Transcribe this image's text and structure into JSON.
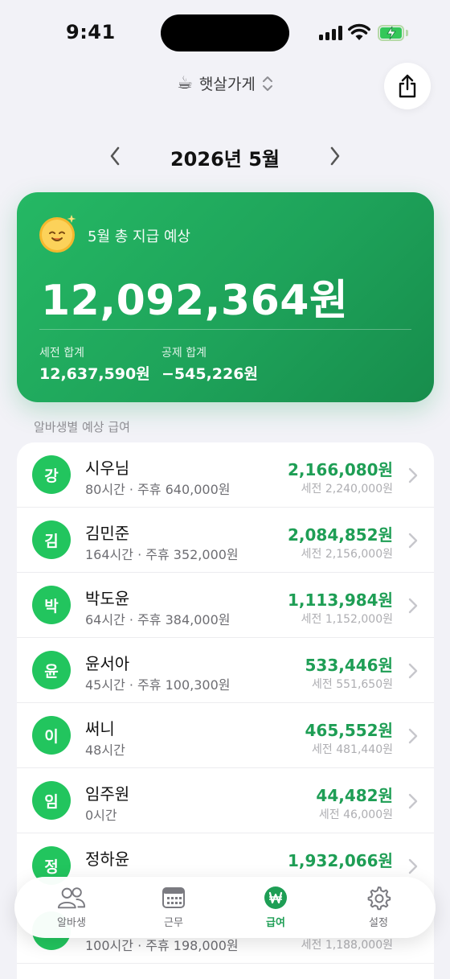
{
  "status": {
    "time": "9:41"
  },
  "store": {
    "icon": "coffee-cup-icon",
    "name": "햇살가게"
  },
  "month": {
    "title": "2026년 5월"
  },
  "summary": {
    "label": "5월 총 지급 예상",
    "total": "12,092,364원",
    "gross_label": "세전 합계",
    "gross_value": "12,637,590원",
    "deduction_label": "공제 합계",
    "deduction_value": "−545,226원"
  },
  "section_title": "알바생별 예상 급여",
  "employees": [
    {
      "initial": "강",
      "name": "시우님",
      "sub": "80시간 · 주휴 640,000원",
      "net": "2,166,080원",
      "gross": "세전 2,240,000원"
    },
    {
      "initial": "김",
      "name": "김민준",
      "sub": "164시간 · 주휴 352,000원",
      "net": "2,084,852원",
      "gross": "세전 2,156,000원"
    },
    {
      "initial": "박",
      "name": "박도윤",
      "sub": "64시간 · 주휴 384,000원",
      "net": "1,113,984원",
      "gross": "세전 1,152,000원"
    },
    {
      "initial": "윤",
      "name": "윤서아",
      "sub": "45시간 · 주휴 100,300원",
      "net": "533,446원",
      "gross": "세전 551,650원"
    },
    {
      "initial": "이",
      "name": "써니",
      "sub": "48시간",
      "net": "465,552원",
      "gross": "세전 481,440원"
    },
    {
      "initial": "임",
      "name": "임주원",
      "sub": "0시간",
      "net": "44,482원",
      "gross": "세전 46,000원"
    },
    {
      "initial": "정",
      "name": "정하윤",
      "sub": "",
      "net": "1,932,066원",
      "gross": ""
    },
    {
      "initial": "",
      "name": "",
      "sub": "100시간 · 주휴 198,000원",
      "net": "",
      "gross": "세전 1,188,000원"
    }
  ],
  "tabs": [
    {
      "label": "알바생",
      "icon": "people-icon",
      "active": false
    },
    {
      "label": "근무",
      "icon": "calendar-icon",
      "active": false
    },
    {
      "label": "급여",
      "icon": "won-icon",
      "active": true
    },
    {
      "label": "설정",
      "icon": "gear-icon",
      "active": false
    }
  ],
  "colors": {
    "accent": "#1e9e55",
    "avatar": "#22c55e",
    "card": "#1ea35a"
  }
}
